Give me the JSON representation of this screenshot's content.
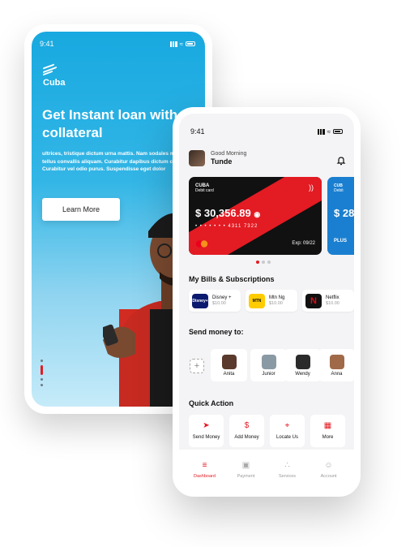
{
  "back_phone": {
    "time": "9:41",
    "brand": "Cuba",
    "headline": "Get Instant loan with no collateral",
    "body": "ultrices, tristique dictum urna mattis. Nam sodales molestie tellus convallis aliquam. Curabitur dapibus dictum consectetur. Curabitur vel odio purus. Suspendisse eget dolor",
    "cta_label": "Learn More",
    "carousel_active_index": 0
  },
  "front_phone": {
    "time": "9:41",
    "greeting": "Good Morning",
    "user_name": "Tunde",
    "cards": [
      {
        "brand": "CUBA",
        "type": "Debit card",
        "balance": "$ 30,356.89",
        "number": "• • • • • • •  4311  7322",
        "expiry": "Exp: 09/22",
        "color": "#e31b23"
      },
      {
        "brand": "CUB",
        "type": "Debit",
        "balance": "$ 28",
        "network": "PLUS",
        "color": "#1a7fd0"
      }
    ],
    "bills_title": "My Bills & Subscriptions",
    "bills": [
      {
        "name": "Disney +",
        "price": "$10.00",
        "logo_text": "Disney+",
        "logo_bg": "#0b1a6e",
        "logo_fg": "#ffffff"
      },
      {
        "name": "Mtn Ng",
        "price": "$10.00",
        "logo_text": "MTN",
        "logo_bg": "#ffcc00",
        "logo_fg": "#111111"
      },
      {
        "name": "Netflix",
        "price": "$10.00",
        "logo_text": "N",
        "logo_bg": "#111111",
        "logo_fg": "#e50914"
      }
    ],
    "send_title": "Send money to:",
    "add_label": "+",
    "contacts": [
      {
        "name": "Anita",
        "color": "#5a3a2c"
      },
      {
        "name": "Junior",
        "color": "#8a9aa4"
      },
      {
        "name": "Wendy",
        "color": "#2b2b2b"
      },
      {
        "name": "Anna",
        "color": "#a06a48"
      }
    ],
    "quick_title": "Quick Action",
    "quick_actions": [
      {
        "label": "Send Money",
        "icon": "send-icon",
        "glyph": "➤"
      },
      {
        "label": "Add Money",
        "icon": "dollar-icon",
        "glyph": "$"
      },
      {
        "label": "Locate Us",
        "icon": "location-icon",
        "glyph": "⌖"
      },
      {
        "label": "More",
        "icon": "grid-icon",
        "glyph": "▦"
      }
    ],
    "nav": [
      {
        "label": "Dashboard",
        "icon": "dashboard-icon",
        "glyph": "≡",
        "active": true
      },
      {
        "label": "Payment",
        "icon": "wallet-icon",
        "glyph": "▣",
        "active": false
      },
      {
        "label": "Services",
        "icon": "services-icon",
        "glyph": "∴",
        "active": false
      },
      {
        "label": "Account",
        "icon": "account-icon",
        "glyph": "☺",
        "active": false
      }
    ],
    "accent_color": "#e31b23"
  }
}
